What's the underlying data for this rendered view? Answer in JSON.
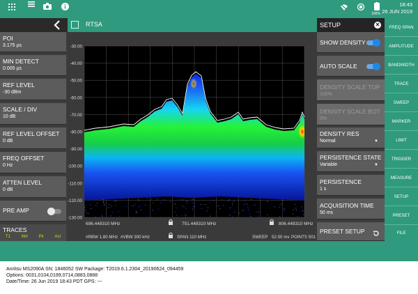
{
  "status_bar": {
    "time": "18:43",
    "date": "26 JUN 2019",
    "battery": "100%",
    "icons": [
      "apps-grid-icon",
      "camera-icon",
      "info-icon",
      "wifi-off-icon",
      "rotation-lock-icon",
      "battery-icon"
    ]
  },
  "left_panel": {
    "back_icon": "back-arrow-icon",
    "items": [
      {
        "label": "POI",
        "value": "3.175 µs"
      },
      {
        "label": "MIN DETECT",
        "value": "0.005 µs"
      },
      {
        "label": "REF LEVEL",
        "value": "-30 dBm"
      },
      {
        "label": "SCALE / DIV",
        "value": "10 dB"
      },
      {
        "label": "REF LEVEL OFFSET",
        "value": "0 dB"
      },
      {
        "label": "FREQ OFFSET",
        "value": "0 Hz"
      },
      {
        "label": "ATTEN LEVEL",
        "value": "0 dB"
      }
    ],
    "pre_amp": {
      "label": "PRE AMP",
      "on": false
    },
    "traces": {
      "label": "TRACES",
      "modes": [
        "T1",
        "Wrt",
        "Pk",
        "Act"
      ]
    }
  },
  "mode_bar": {
    "title": "RTSA",
    "icon": "mode-icon"
  },
  "plot": {
    "y_ticks": [
      "-30.00",
      "-40.00",
      "-50.00",
      "-60.00",
      "-70.00",
      "-80.00",
      "-90.00",
      "-100.00",
      "-110.00",
      "-120.00",
      "-130.00"
    ],
    "freq_start": "696.448310 MHz",
    "freq_center": "751.448310 MHz",
    "freq_stop": "806.448310 MHz",
    "rbw": "#RBW 1.80 MHz",
    "vbw": "#VBW 300 kHz",
    "span": "SPAN 110 MHz",
    "sweep_label": "SWEEP",
    "sweep_value": "52.50 ms",
    "points": "POINTS 501",
    "colors": {
      "background": "#000000",
      "trace": "#ffffff",
      "density_high": "#ff3000",
      "density_mid": "#20ff20",
      "density_low": "#0a40ff"
    }
  },
  "setup": {
    "title": "SETUP",
    "show_density": {
      "label": "SHOW DENSITY",
      "on": true
    },
    "auto_scale": {
      "label": "AUTO SCALE",
      "on": true
    },
    "density_scale_top": {
      "label": "DENSITY SCALE TOP",
      "value": "100%"
    },
    "density_scale_bot": {
      "label": "DENSITY SCALE BOT",
      "value": "0%"
    },
    "density_res": {
      "label": "DENSITY RES",
      "value": "Normal"
    },
    "persistence_state": {
      "label": "PERSISTENCE STATE",
      "value": "Variable"
    },
    "persistence": {
      "label": "PERSISTENCE",
      "value": "1 s"
    },
    "acquisition_time": {
      "label": "ACQUISITION TIME",
      "value": "50 ms"
    },
    "preset_setup": {
      "label": "PRESET SETUP"
    }
  },
  "right_menu": [
    "FREQ SPAN",
    "AMPLITUDE",
    "BANDWIDTH",
    "TRACE",
    "SWEEP",
    "MARKER",
    "LIMIT",
    "TRIGGER",
    "MEASURE",
    "SETUP",
    "PRESET",
    "FILE"
  ],
  "footer": [
    "Anritsu MS2090A SN: 1846052 SW Package: T2019.6.1.2304_20190624_094459",
    "Options: 0031,0104,0199,0714,0883,0888",
    "Date/Time: 26 Jun 2019 18:43 PDT GPS: ---"
  ],
  "accent_color": "#2f9a7d"
}
